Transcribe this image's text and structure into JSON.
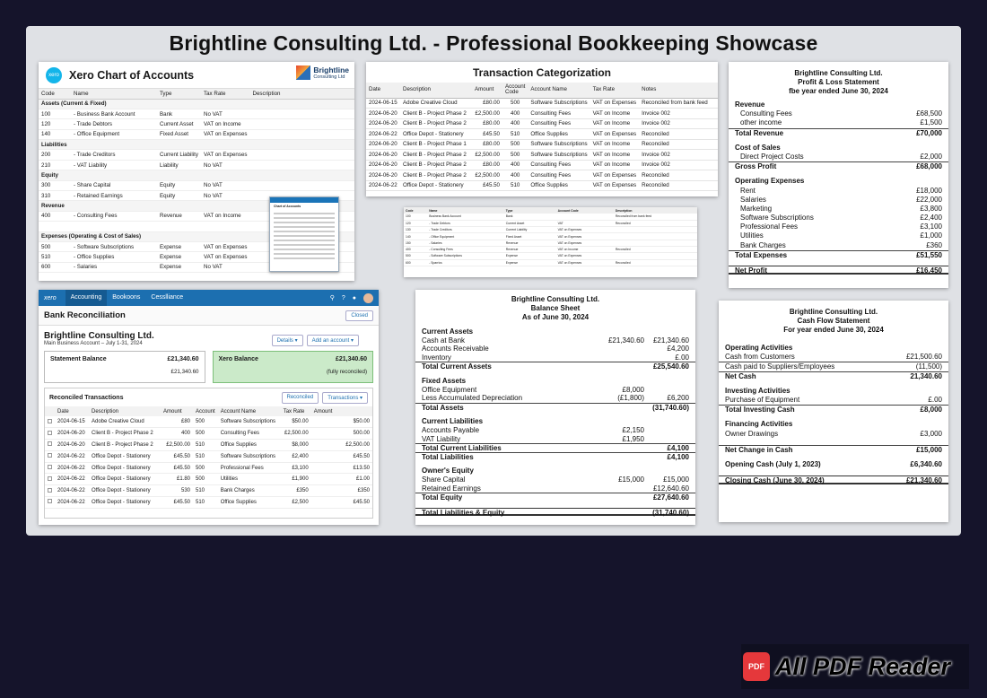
{
  "title": "Brightline Consulting Ltd. - Professional Bookkeeping Showcase",
  "coa": {
    "title": "Xero Chart of Accounts",
    "brand_name": "Brightline",
    "brand_sub": "Consulting Ltd",
    "xero": "xero",
    "headers": [
      "Code",
      "Name",
      "Type",
      "Tax Rate",
      "Description"
    ],
    "rows": [
      {
        "sec": "Assets (Current & Fixed)"
      },
      {
        "code": "100",
        "name": "- Business Bank Account",
        "type": "Bank",
        "tax": "No VAT"
      },
      {
        "code": "120",
        "name": "- Trade Debtors",
        "type": "Current Asset",
        "tax": "VAT on Income"
      },
      {
        "code": "140",
        "name": "- Office Equipment",
        "type": "Fixed Asset",
        "tax": "VAT on Expenses"
      },
      {
        "sec": "Liabilities"
      },
      {
        "code": "200",
        "name": "- Trade Creditors",
        "type": "Current Liability",
        "tax": "VAT on Expenses"
      },
      {
        "code": "210",
        "name": "- VAT Liability",
        "type": "Liability",
        "tax": "No VAT"
      },
      {
        "sec": "Equity"
      },
      {
        "code": "300",
        "name": "- Share Capital",
        "type": "Equity",
        "tax": "No VAT"
      },
      {
        "code": "310",
        "name": "- Retained Earnings",
        "type": "Equity",
        "tax": "No VAT"
      },
      {
        "sec": "Revenue"
      },
      {
        "code": "400",
        "name": "- Consulting Fees",
        "type": "Revenue",
        "tax": "VAT on Income"
      },
      {
        "blank": ""
      },
      {
        "sec": "Expenses (Operating & Cost of Sales)"
      },
      {
        "code": "500",
        "name": "- Software Subscriptions",
        "type": "Expense",
        "tax": "VAT on Expenses"
      },
      {
        "code": "510",
        "name": "- Office Supplies",
        "type": "Expense",
        "tax": "VAT on Expenses"
      },
      {
        "code": "600",
        "name": "- Salaries",
        "type": "Expense",
        "tax": "No VAT"
      }
    ],
    "mini_title": "Chart of Accounts"
  },
  "tx": {
    "title": "Transaction Categorization",
    "headers": [
      "Date",
      "Description",
      "Amount",
      "Account Code",
      "Account Name",
      "Tax Rate",
      "Notes"
    ],
    "rows": [
      [
        "2024-06-15",
        "Adobe Creative Cloud",
        "£80.00",
        "500",
        "Software Subscriptions",
        "VAT on Expenses",
        "Reconciled from bank feed"
      ],
      [
        "2024-06-20",
        "Client B - Project Phase 2",
        "£2,500.00",
        "400",
        "Consulting Fees",
        "VAT on Income",
        "Invoice 002"
      ],
      [
        "2024-06-20",
        "Client B - Project Phase 2",
        "£80.00",
        "400",
        "Consulting Fees",
        "VAT on Income",
        "Invoice 002"
      ],
      [
        "2024-06-22",
        "Office Depot - Stationery",
        "£45.50",
        "510",
        "Office Supplies",
        "VAT on Expenses",
        "Reconciled"
      ],
      [
        "2024-06-20",
        "Client B - Project Phase 1",
        "£80.00",
        "500",
        "Software Subscriptions",
        "VAT on Income",
        "Reconciled"
      ],
      [
        "2024-06-20",
        "Client B - Project Phase 2",
        "£2,500.00",
        "500",
        "Software Subscriptions",
        "VAT on Income",
        "Invoice 002"
      ],
      [
        "2024-06-20",
        "Client B - Project Phase 2",
        "£80.00",
        "400",
        "Consulting Fees",
        "VAT on Income",
        "Invoice 002"
      ],
      [
        "2024-06-20",
        "Client B - Project Phase 2",
        "£2,500.00",
        "400",
        "Consulting Fees",
        "VAT on Expenses",
        "Reconciled"
      ],
      [
        "2024-06-22",
        "Office Depot - Stationery",
        "£45.50",
        "510",
        "Office Supplies",
        "VAT on Expenses",
        "Reconciled"
      ]
    ]
  },
  "mini": {
    "headers": [
      "Code",
      "Name",
      "Type",
      "Account Code",
      "Description"
    ],
    "rows": [
      [
        "100",
        "Business Bank Account",
        "Bank",
        "",
        "Reconciled from bank feed"
      ],
      [
        "120",
        "- Trade Debtors",
        "Current Asset",
        "VAT",
        "Reconciled"
      ],
      [
        "130",
        "- Trade Creditors",
        "Current Liability",
        "VAT on Expenses",
        ""
      ],
      [
        "140",
        "- Office Equipment",
        "Fixed Asset",
        "VAT on Expenses",
        ""
      ],
      [
        "150",
        "- Salaries",
        "Revenue",
        "VAT on Expenses",
        ""
      ],
      [
        "400",
        "- Consulting Fees",
        "Revenue",
        "VAT on Income",
        "Reconciled"
      ],
      [
        "500",
        "- Software Subscriptions",
        "Expense",
        "VAT on Expenses",
        ""
      ],
      [
        "600",
        "- Sparrics",
        "Expense",
        "VAT on Expenses",
        "Reconciled"
      ]
    ]
  },
  "pl": {
    "h1": "Brightline Consulting Ltd.",
    "h2": "Profit & Loss Statement",
    "h3": "fbe year ended June 30, 2024",
    "revenue_h": "Revenue",
    "rev": [
      [
        "Consulting Fees",
        "£68,500"
      ],
      [
        "other income",
        "£1,500"
      ]
    ],
    "total_rev": [
      "Total Revenue",
      "£70,000"
    ],
    "cos_h": "Cost of Sales",
    "cos": [
      [
        "Direct Project Costs",
        "£2,000"
      ]
    ],
    "gross": [
      "Gross Profit",
      "£68,000"
    ],
    "opex_h": "Operating Expenses",
    "opex": [
      [
        "Rent",
        "£18,000"
      ],
      [
        "Salaries",
        "£22,000"
      ],
      [
        "Marketing",
        "£3,800"
      ],
      [
        "Software Subscriptions",
        "£2,400"
      ],
      [
        "Professional Fees",
        "£3,100"
      ],
      [
        "Utilities",
        "£1,000"
      ],
      [
        "Bank Charges",
        "£360"
      ]
    ],
    "total_exp": [
      "Total Expenses",
      "£51,550"
    ],
    "net": [
      "Net Profit",
      "£16,450"
    ]
  },
  "bs": {
    "h1": "Brightline Consulting Ltd.",
    "h2": "Balance Sheet",
    "h3": "As of June 30, 2024",
    "rows": [
      {
        "t": "Current Assets",
        "b": 1
      },
      {
        "t": "Cash at Bank",
        "a": "£21,340.60",
        "c": "£21,340.60"
      },
      {
        "t": "Accounts Receivable",
        "a": "",
        "c": "£4,200"
      },
      {
        "t": "Inventory",
        "a": "",
        "c": "£.00"
      },
      {
        "t": "Total Current Assets",
        "a": "",
        "c": "£25,540.60",
        "b": 1,
        "tl": 1
      },
      {
        "gap": 1
      },
      {
        "t": "Fixed Assets",
        "b": 1
      },
      {
        "t": "Office Equipment",
        "a": "£8,000",
        "c": ""
      },
      {
        "t": "Less Accumulated Depreciation",
        "a": "(£1,800)",
        "c": "£6,200"
      },
      {
        "t": "Total Assets",
        "a": "",
        "c": "(31,740.60)",
        "b": 1,
        "tl": 1
      },
      {
        "gap": 1
      },
      {
        "t": "Current Liabilities",
        "b": 1
      },
      {
        "t": "Accounts Payable",
        "a": "£2,150",
        "c": ""
      },
      {
        "t": "VAT Liability",
        "a": "£1,950",
        "c": ""
      },
      {
        "t": "Total Current Liabilities",
        "a": "",
        "c": "£4,100",
        "b": 1,
        "tl": 1
      },
      {
        "t": "Total Liabilities",
        "a": "",
        "c": "£4,100",
        "b": 1,
        "tl": 1
      },
      {
        "gap": 1
      },
      {
        "t": "Owner's Equity",
        "b": 1
      },
      {
        "t": "Share Capital",
        "a": "£15,000",
        "c": "£15,000"
      },
      {
        "t": "Retained Earnings",
        "a": "",
        "c": "£12,640.60"
      },
      {
        "t": "Total Equity",
        "a": "",
        "c": "£27,640.60",
        "b": 1,
        "tl": 1
      },
      {
        "gap": 1
      },
      {
        "t": "Total Liabilities & Equity",
        "a": "",
        "c": "(31,740.60)",
        "b": 1,
        "dbl": 1
      }
    ]
  },
  "cf": {
    "h1": "Brightline Consulting Ltd.",
    "h2": "Cash Flow Statement",
    "h3": "For year ended June 30, 2024",
    "rows": [
      {
        "t": "Operating Activities",
        "b": 1
      },
      {
        "t": "Cash from Customers",
        "v": "£21,500.60"
      },
      {
        "t": "Cash paid to Suppliers/Employees",
        "v": "(11,500)",
        "tl": 1
      },
      {
        "t": "Net Cash",
        "v": "21,340.60",
        "b": 1,
        "tl": 1
      },
      {
        "gap": 1
      },
      {
        "t": "Investing Activities",
        "b": 1
      },
      {
        "t": "Purchase of Equipment",
        "v": "£.00"
      },
      {
        "t": "Total Investing Cash",
        "v": "£8,000",
        "b": 1,
        "tl": 1
      },
      {
        "gap": 1
      },
      {
        "t": "Financing Activities",
        "b": 1
      },
      {
        "t": "Owner Drawings",
        "v": "£3,000"
      },
      {
        "gap": 1
      },
      {
        "t": "Net Change in Cash",
        "v": "£15,000",
        "b": 1,
        "tl": 1
      },
      {
        "gap": 1
      },
      {
        "t": "Opening Cash (July 1, 2023)",
        "v": "£6,340.60",
        "b": 1
      },
      {
        "gap": 1
      },
      {
        "t": "Closing Cash (June 30, 2024)",
        "v": "£21,340.60",
        "b": 1,
        "dbl": 1
      }
    ]
  },
  "br": {
    "xero": "xero",
    "tabs": [
      "Accounting",
      "Bookoons",
      "Cesslliance"
    ],
    "section": "Bank Reconciliation",
    "closed": "Closed",
    "company": "Brightline Consulting Ltd.",
    "account": "Main Business Account – July 1-31, 2024",
    "details": "Details ▾",
    "add": "Add an account ▾",
    "stmt_label": "Statement Balance",
    "stmt_val": "£21,340.60",
    "stmt_sub": "£21,340.60",
    "xero_label": "Xero Balance",
    "xero_val": "£21,340.60",
    "xero_sub": "(fully reconciled)",
    "rt_title": "Reconciled Transactions",
    "reconciled_btn": "Reconciled",
    "tx_btn": "Transactions ▾",
    "headers": [
      "",
      "Date",
      "Description",
      "Amount",
      "Account",
      "Account Name",
      "Tax Rate",
      "Amount"
    ],
    "rows": [
      [
        "2024-06-15",
        "Adobe Creative Cloud",
        "£80",
        "500",
        "Software Subscriptions",
        "$50.00",
        "$50.00"
      ],
      [
        "2024-06-20",
        "Client B - Project Phase 2",
        "400",
        "500",
        "Consulting Fees",
        "£2,500.00",
        "500.00"
      ],
      [
        "2024-06-20",
        "Client B - Project Phase 2",
        "£2,500.00",
        "510",
        "Office Supplies",
        "$8,000",
        "£2,500.00"
      ],
      [
        "2024-06-22",
        "Office Depot - Stationery",
        "£45.50",
        "510",
        "Software Subscriptions",
        "£2,400",
        "£45.50"
      ],
      [
        "2024-06-22",
        "Office Depot - Stationery",
        "£45.50",
        "500",
        "Professional Fees",
        "£3,100",
        "£13.50"
      ],
      [
        "2024-06-22",
        "Office Depot - Stationery",
        "£1.80",
        "500",
        "Utilities",
        "£1,900",
        "£1.00"
      ],
      [
        "2024-06-22",
        "Office Depot - Stationery",
        "530",
        "510",
        "Bank Charges",
        "£350",
        "£350"
      ],
      [
        "2024-06-22",
        "Office Depot - Stationery",
        "£45.50",
        "510",
        "Office Supplies",
        "£2,500",
        "£45.50"
      ]
    ]
  },
  "watermark": {
    "icon": "PDF",
    "text": "All PDF Reader"
  }
}
